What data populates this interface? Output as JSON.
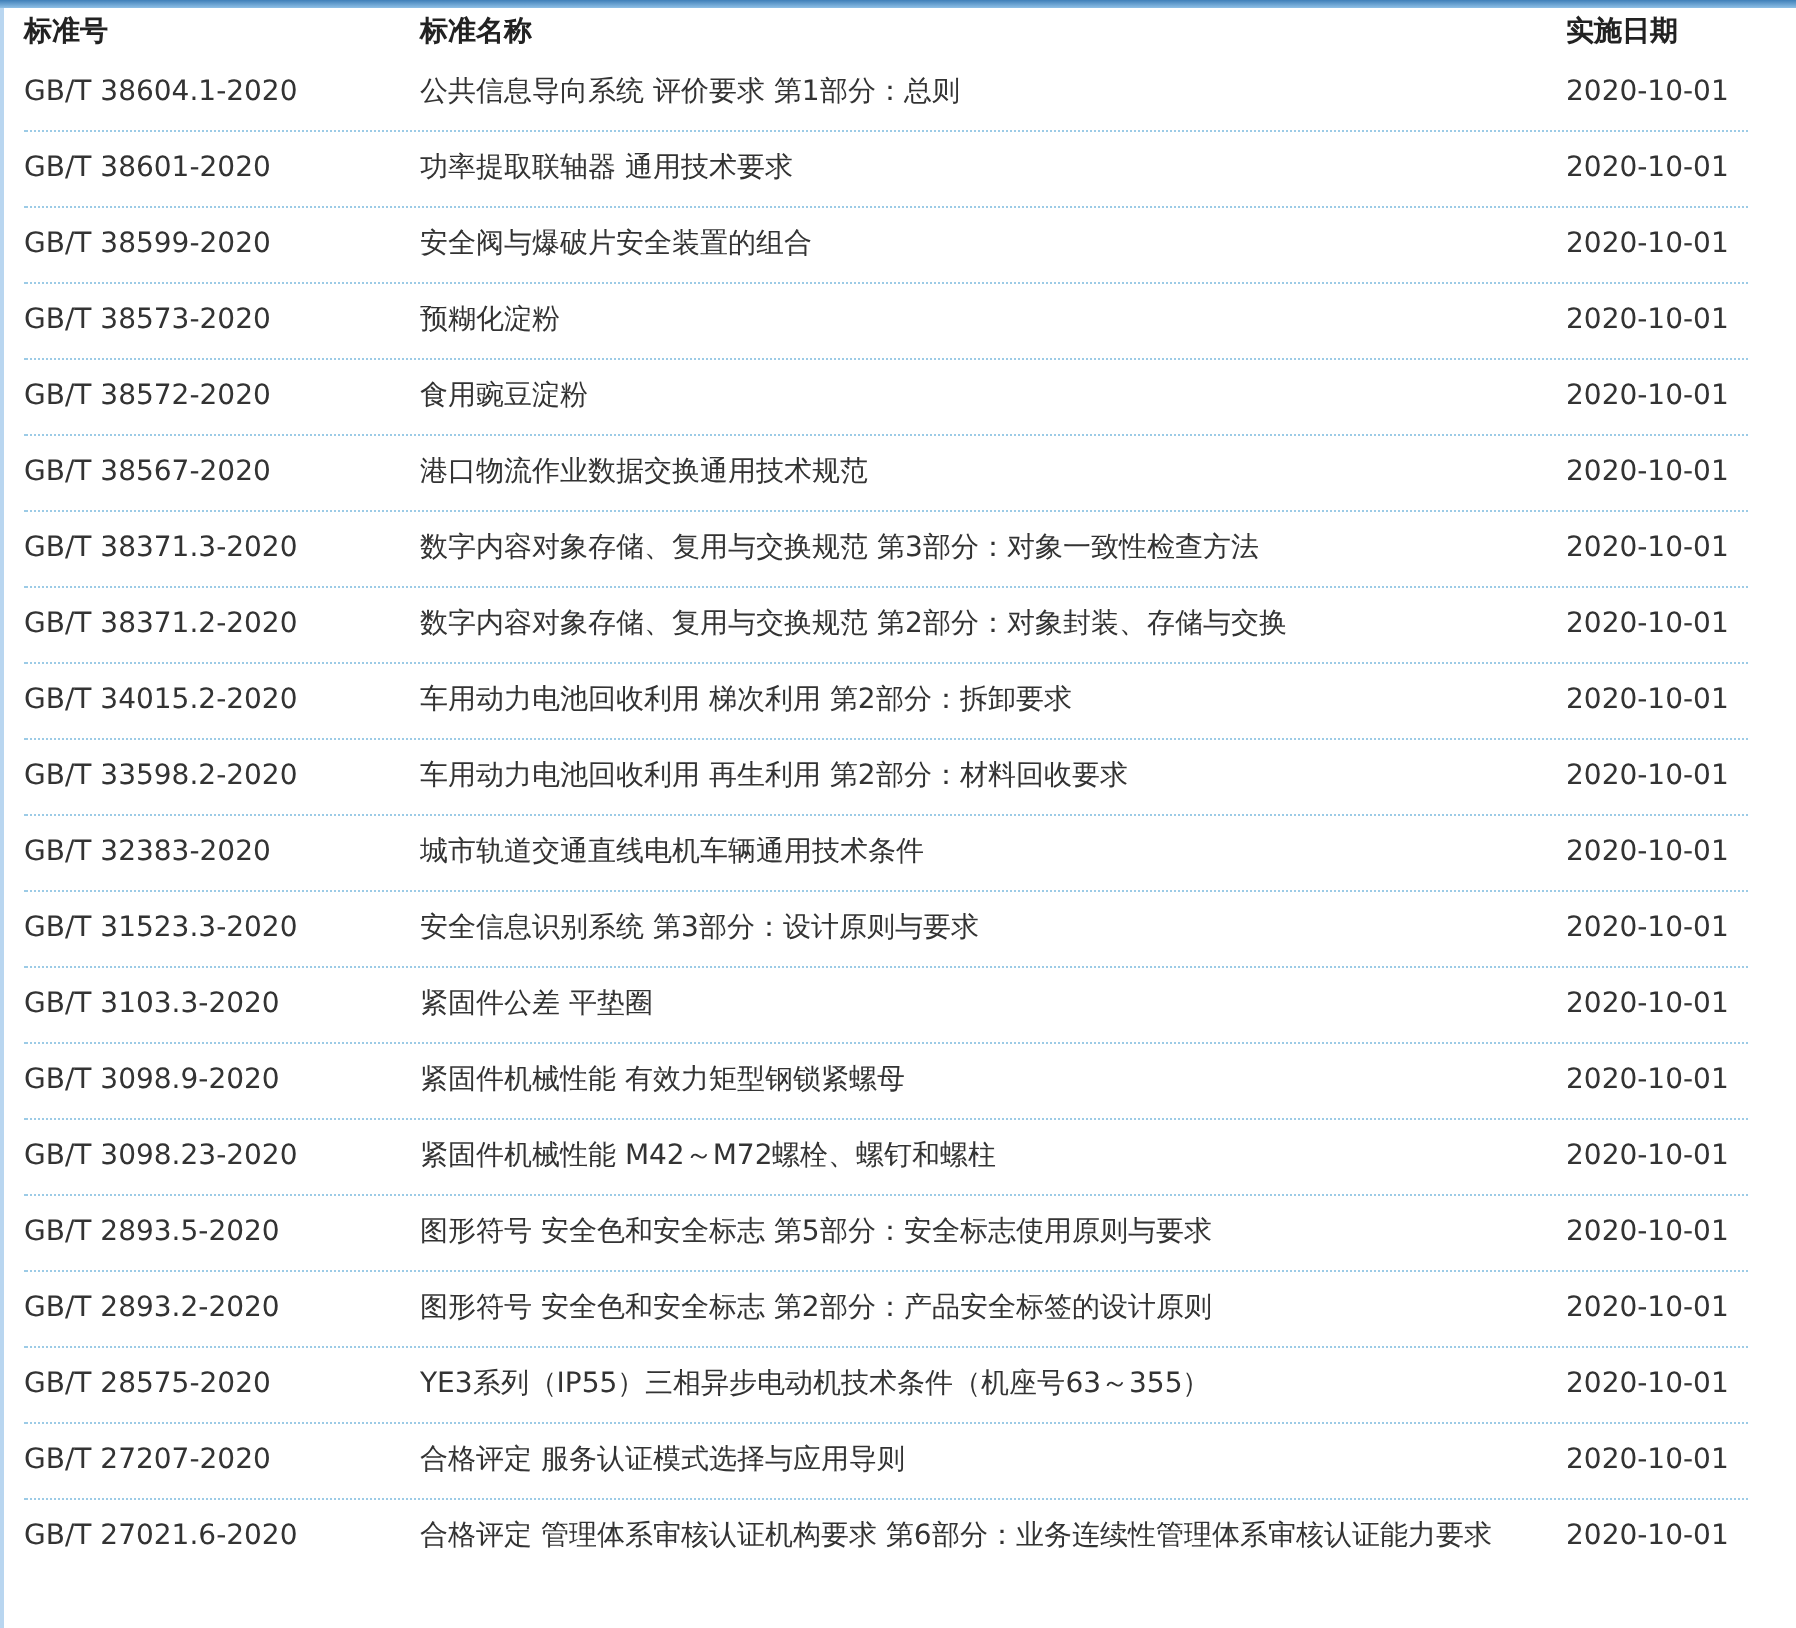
{
  "table": {
    "columns": [
      "标准号",
      "标准名称",
      "实施日期"
    ],
    "rows": [
      {
        "code": "GB/T 38604.1-2020",
        "name": "公共信息导向系统 评价要求 第1部分：总则",
        "date": "2020-10-01"
      },
      {
        "code": "GB/T 38601-2020",
        "name": "功率提取联轴器 通用技术要求",
        "date": "2020-10-01"
      },
      {
        "code": "GB/T 38599-2020",
        "name": "安全阀与爆破片安全装置的组合",
        "date": "2020-10-01"
      },
      {
        "code": "GB/T 38573-2020",
        "name": "预糊化淀粉",
        "date": "2020-10-01"
      },
      {
        "code": "GB/T 38572-2020",
        "name": "食用豌豆淀粉",
        "date": "2020-10-01"
      },
      {
        "code": "GB/T 38567-2020",
        "name": "港口物流作业数据交换通用技术规范",
        "date": "2020-10-01"
      },
      {
        "code": "GB/T 38371.3-2020",
        "name": "数字内容对象存储、复用与交换规范 第3部分：对象一致性检查方法",
        "date": "2020-10-01"
      },
      {
        "code": "GB/T 38371.2-2020",
        "name": "数字内容对象存储、复用与交换规范 第2部分：对象封装、存储与交换",
        "date": "2020-10-01"
      },
      {
        "code": "GB/T 34015.2-2020",
        "name": "车用动力电池回收利用 梯次利用 第2部分：拆卸要求",
        "date": "2020-10-01"
      },
      {
        "code": "GB/T 33598.2-2020",
        "name": "车用动力电池回收利用 再生利用 第2部分：材料回收要求",
        "date": "2020-10-01"
      },
      {
        "code": "GB/T 32383-2020",
        "name": "城市轨道交通直线电机车辆通用技术条件",
        "date": "2020-10-01"
      },
      {
        "code": "GB/T 31523.3-2020",
        "name": "安全信息识别系统 第3部分：设计原则与要求",
        "date": "2020-10-01"
      },
      {
        "code": "GB/T 3103.3-2020",
        "name": "紧固件公差 平垫圈",
        "date": "2020-10-01"
      },
      {
        "code": "GB/T 3098.9-2020",
        "name": "紧固件机械性能 有效力矩型钢锁紧螺母",
        "date": "2020-10-01"
      },
      {
        "code": "GB/T 3098.23-2020",
        "name": "紧固件机械性能 M42～M72螺栓、螺钉和螺柱",
        "date": "2020-10-01"
      },
      {
        "code": "GB/T 2893.5-2020",
        "name": "图形符号 安全色和安全标志 第5部分：安全标志使用原则与要求",
        "date": "2020-10-01"
      },
      {
        "code": "GB/T 2893.2-2020",
        "name": "图形符号 安全色和安全标志 第2部分：产品安全标签的设计原则",
        "date": "2020-10-01"
      },
      {
        "code": "GB/T 28575-2020",
        "name": "YE3系列（IP55）三相异步电动机技术条件（机座号63～355）",
        "date": "2020-10-01"
      },
      {
        "code": "GB/T 27207-2020",
        "name": "合格评定 服务认证模式选择与应用导则",
        "date": "2020-10-01"
      },
      {
        "code": "GB/T 27021.6-2020",
        "name": "合格评定 管理体系审核认证机构要求 第6部分：业务连续性管理体系审核认证能力要求",
        "date": "2020-10-01"
      }
    ]
  }
}
